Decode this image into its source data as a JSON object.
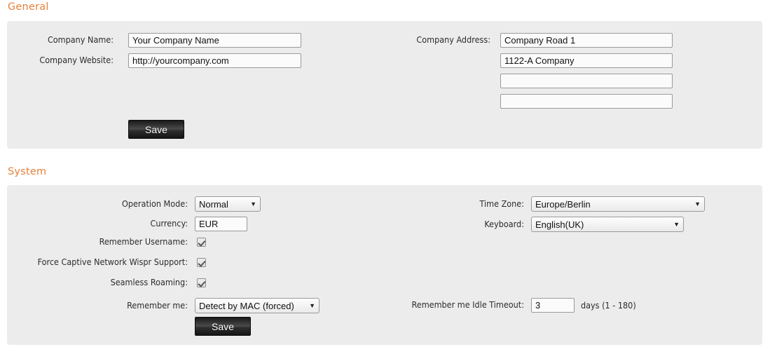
{
  "sections": {
    "general": {
      "title": "General",
      "fields": {
        "company_name_label": "Company Name:",
        "company_name_value": "Your Company Name",
        "company_website_label": "Company Website:",
        "company_website_value": "http://yourcompany.com",
        "company_address_label": "Company Address:",
        "company_address_line1": "Company Road 1",
        "company_address_line2": "1122-A Company",
        "company_address_line3": "",
        "company_address_line4": ""
      },
      "save_label": "Save"
    },
    "system": {
      "title": "System",
      "fields": {
        "operation_mode_label": "Operation Mode:",
        "operation_mode_value": "Normal",
        "currency_label": "Currency:",
        "currency_value": "EUR",
        "remember_username_label": "Remember Username:",
        "remember_username_checked": "checked",
        "force_captive_label": "Force Captive Network Wispr Support:",
        "force_captive_checked": "checked",
        "seamless_roaming_label": "Seamless Roaming:",
        "seamless_roaming_checked": "checked",
        "remember_me_label": "Remember me:",
        "remember_me_value": "Detect by MAC (forced)",
        "time_zone_label": "Time Zone:",
        "time_zone_value": "Europe/Berlin",
        "keyboard_label": "Keyboard:",
        "keyboard_value": "English(UK)",
        "idle_timeout_label": "Remember me Idle Timeout:",
        "idle_timeout_value": "3",
        "idle_timeout_suffix": "days (1 - 180)"
      },
      "save_label": "Save"
    }
  },
  "icons": {
    "dropdown_caret": "▼"
  },
  "colors": {
    "heading": "#e8803a",
    "panel_bg": "#ececec",
    "input_border": "#9a9a9a",
    "button_bg": "#232323"
  }
}
